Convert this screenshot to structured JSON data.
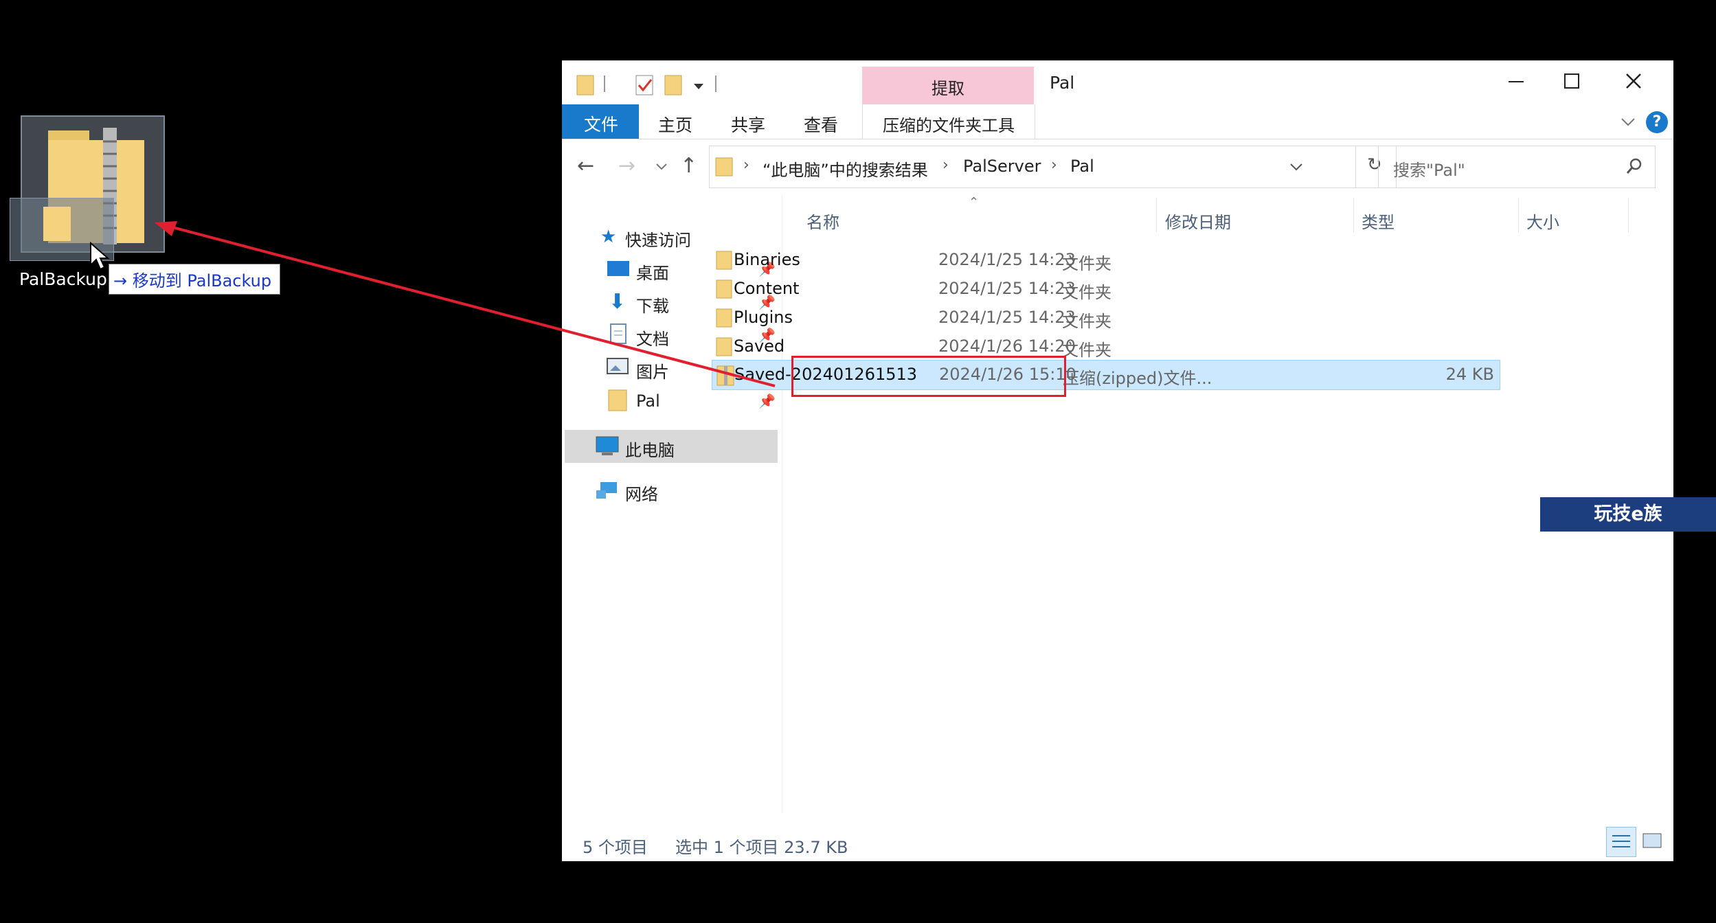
{
  "desktop": {
    "icon_label": "PalBackup",
    "drag_tooltip": "→ 移动到 PalBackup"
  },
  "window": {
    "title": "Pal",
    "context_tab_label": "提取",
    "ribbon_tabs": [
      "文件",
      "主页",
      "共享",
      "查看"
    ],
    "context_sub_label": "压缩的文件夹工具",
    "address": {
      "crumbs": [
        "“此电脑”中的搜索结果",
        "PalServer",
        "Pal"
      ]
    },
    "search_placeholder": "搜索\"Pal\""
  },
  "nav": {
    "quick_access": "快速访问",
    "items": [
      "桌面",
      "下载",
      "文档",
      "图片",
      "Pal"
    ],
    "this_pc": "此电脑",
    "network": "网络"
  },
  "columns": [
    "名称",
    "修改日期",
    "类型",
    "大小"
  ],
  "files": [
    {
      "name": "Binaries",
      "date": "2024/1/25 14:23",
      "type": "文件夹",
      "size": ""
    },
    {
      "name": "Content",
      "date": "2024/1/25 14:23",
      "type": "文件夹",
      "size": ""
    },
    {
      "name": "Plugins",
      "date": "2024/1/25 14:23",
      "type": "文件夹",
      "size": ""
    },
    {
      "name": "Saved",
      "date": "2024/1/26 14:20",
      "type": "文件夹",
      "size": ""
    },
    {
      "name": "Saved-202401261513",
      "date": "2024/1/26 15:10",
      "type": "压缩(zipped)文件...",
      "size": "24 KB"
    }
  ],
  "status": {
    "count": "5 个项目",
    "selection": "选中 1 个项目  23.7 KB"
  },
  "watermark": "玩技e族",
  "colors": {
    "accent": "#1979ca",
    "context_tab": "#f8c7d7",
    "selection": "#cce8ff",
    "annotation_red": "#e0202e"
  }
}
